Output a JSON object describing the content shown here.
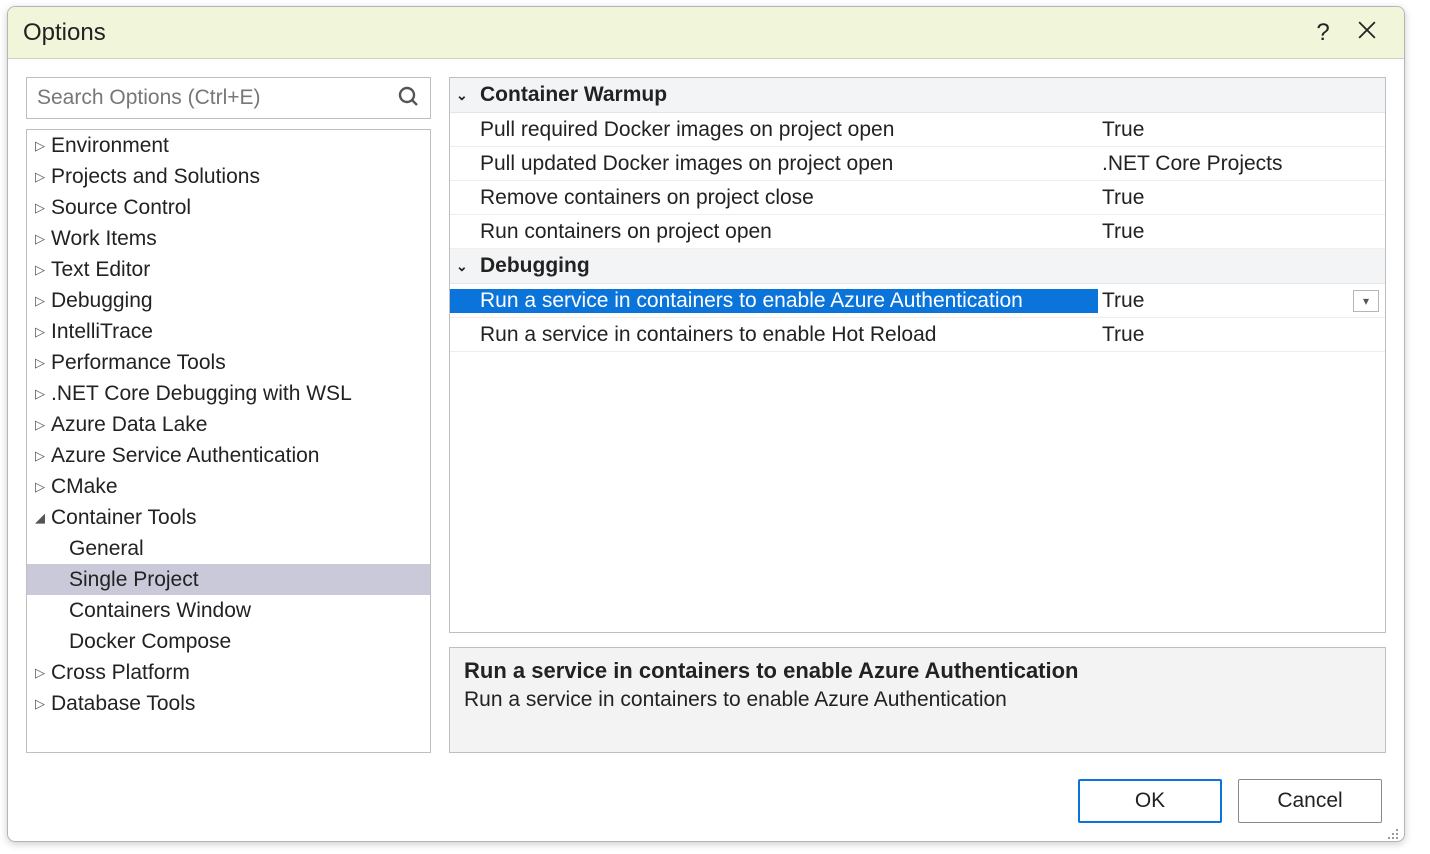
{
  "dialog": {
    "title": "Options",
    "help_tooltip": "?"
  },
  "search": {
    "placeholder": "Search Options (Ctrl+E)",
    "value": ""
  },
  "tree": {
    "items": [
      {
        "label": "Environment",
        "level": 0,
        "expanded": false,
        "selected": false,
        "hasChildren": true
      },
      {
        "label": "Projects and Solutions",
        "level": 0,
        "expanded": false,
        "selected": false,
        "hasChildren": true
      },
      {
        "label": "Source Control",
        "level": 0,
        "expanded": false,
        "selected": false,
        "hasChildren": true
      },
      {
        "label": "Work Items",
        "level": 0,
        "expanded": false,
        "selected": false,
        "hasChildren": true
      },
      {
        "label": "Text Editor",
        "level": 0,
        "expanded": false,
        "selected": false,
        "hasChildren": true
      },
      {
        "label": "Debugging",
        "level": 0,
        "expanded": false,
        "selected": false,
        "hasChildren": true
      },
      {
        "label": "IntelliTrace",
        "level": 0,
        "expanded": false,
        "selected": false,
        "hasChildren": true
      },
      {
        "label": "Performance Tools",
        "level": 0,
        "expanded": false,
        "selected": false,
        "hasChildren": true
      },
      {
        "label": ".NET Core Debugging with WSL",
        "level": 0,
        "expanded": false,
        "selected": false,
        "hasChildren": true
      },
      {
        "label": "Azure Data Lake",
        "level": 0,
        "expanded": false,
        "selected": false,
        "hasChildren": true
      },
      {
        "label": "Azure Service Authentication",
        "level": 0,
        "expanded": false,
        "selected": false,
        "hasChildren": true
      },
      {
        "label": "CMake",
        "level": 0,
        "expanded": false,
        "selected": false,
        "hasChildren": true
      },
      {
        "label": "Container Tools",
        "level": 0,
        "expanded": true,
        "selected": false,
        "hasChildren": true
      },
      {
        "label": "General",
        "level": 1,
        "expanded": false,
        "selected": false,
        "hasChildren": false
      },
      {
        "label": "Single Project",
        "level": 1,
        "expanded": false,
        "selected": true,
        "hasChildren": false
      },
      {
        "label": "Containers Window",
        "level": 1,
        "expanded": false,
        "selected": false,
        "hasChildren": false
      },
      {
        "label": "Docker Compose",
        "level": 1,
        "expanded": false,
        "selected": false,
        "hasChildren": false
      },
      {
        "label": "Cross Platform",
        "level": 0,
        "expanded": false,
        "selected": false,
        "hasChildren": true
      },
      {
        "label": "Database Tools",
        "level": 0,
        "expanded": false,
        "selected": false,
        "hasChildren": true
      }
    ]
  },
  "propertygrid": {
    "groups": [
      {
        "name": "Container Warmup",
        "expanded": true,
        "rows": [
          {
            "label": "Pull required Docker images on project open",
            "value": "True",
            "selected": false
          },
          {
            "label": "Pull updated Docker images on project open",
            "value": ".NET Core Projects",
            "selected": false
          },
          {
            "label": "Remove containers on project close",
            "value": "True",
            "selected": false
          },
          {
            "label": "Run containers on project open",
            "value": "True",
            "selected": false
          }
        ]
      },
      {
        "name": "Debugging",
        "expanded": true,
        "rows": [
          {
            "label": "Run a service in containers to enable Azure Authentication",
            "value": "True",
            "selected": true
          },
          {
            "label": "Run a service in containers to enable Hot Reload",
            "value": "True",
            "selected": false
          }
        ]
      }
    ],
    "description": {
      "title": "Run a service in containers to enable Azure Authentication",
      "text": "Run a service in containers to enable Azure Authentication"
    }
  },
  "footer": {
    "ok_label": "OK",
    "cancel_label": "Cancel"
  }
}
